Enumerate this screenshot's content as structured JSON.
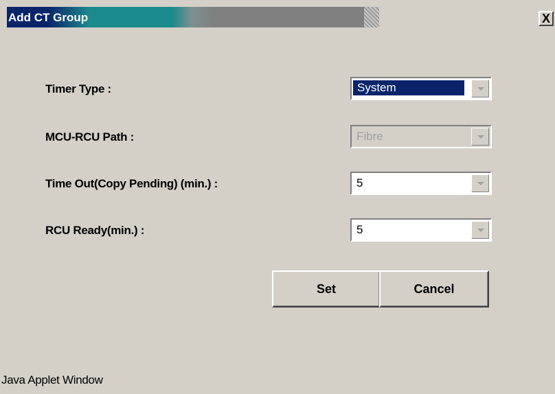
{
  "window": {
    "title": "Add CT Group",
    "close_label": "X",
    "status_text": "Java Applet Window"
  },
  "form": {
    "fields": [
      {
        "label": "Timer Type :",
        "value": "System",
        "state": "selected"
      },
      {
        "label": "MCU-RCU Path :",
        "value": "Fibre",
        "state": "disabled"
      },
      {
        "label": "Time Out(Copy Pending) (min.) :",
        "value": "5",
        "state": "normal"
      },
      {
        "label": "RCU Ready(min.) :",
        "value": "5",
        "state": "normal"
      }
    ]
  },
  "buttons": {
    "set_label": "Set",
    "cancel_label": "Cancel"
  },
  "colors": {
    "dialog_bg": "#d4d0c8",
    "title_start": "#0a246a",
    "title_mid": "#1b8a8c",
    "selection": "#0a246a"
  }
}
